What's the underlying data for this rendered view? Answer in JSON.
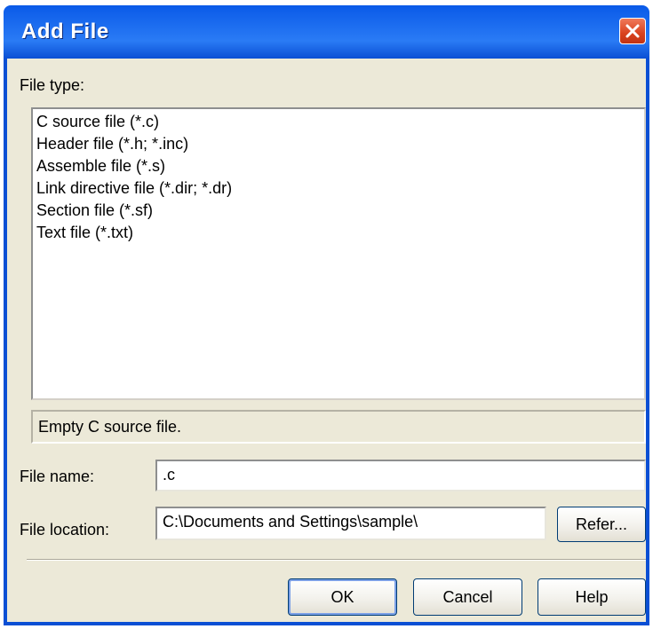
{
  "dialog": {
    "title": "Add File"
  },
  "file_type": {
    "label": "File type:",
    "items": [
      "C source file (*.c)",
      "Header file (*.h; *.inc)",
      "Assemble file (*.s)",
      "Link directive file (*.dir; *.dr)",
      "Section file (*.sf)",
      "Text file (*.txt)"
    ]
  },
  "description": "Empty C source file.",
  "file_name": {
    "label": "File name:",
    "value": ".c"
  },
  "file_location": {
    "label": "File location:",
    "value": "C:\\Documents and Settings\\sample\\",
    "refer_label": "Refer..."
  },
  "buttons": {
    "ok": "OK",
    "cancel": "Cancel",
    "help": "Help"
  },
  "icons": {
    "close": "close-icon"
  },
  "colors": {
    "titlebar": "#0a4fd4",
    "close_button": "#d9421e",
    "dialog_face": "#ece9d8"
  }
}
